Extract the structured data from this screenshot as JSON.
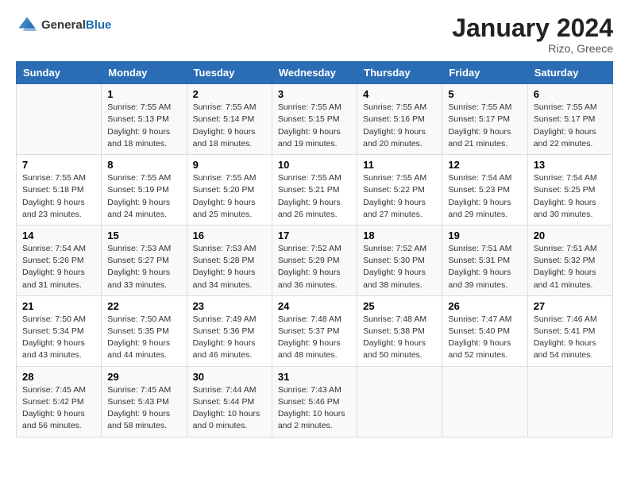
{
  "header": {
    "logo_general": "General",
    "logo_blue": "Blue",
    "month_title": "January 2024",
    "location": "Rizo, Greece"
  },
  "weekdays": [
    "Sunday",
    "Monday",
    "Tuesday",
    "Wednesday",
    "Thursday",
    "Friday",
    "Saturday"
  ],
  "weeks": [
    [
      {
        "day": "",
        "sunrise": "",
        "sunset": "",
        "daylight": ""
      },
      {
        "day": "1",
        "sunrise": "Sunrise: 7:55 AM",
        "sunset": "Sunset: 5:13 PM",
        "daylight": "Daylight: 9 hours and 18 minutes."
      },
      {
        "day": "2",
        "sunrise": "Sunrise: 7:55 AM",
        "sunset": "Sunset: 5:14 PM",
        "daylight": "Daylight: 9 hours and 18 minutes."
      },
      {
        "day": "3",
        "sunrise": "Sunrise: 7:55 AM",
        "sunset": "Sunset: 5:15 PM",
        "daylight": "Daylight: 9 hours and 19 minutes."
      },
      {
        "day": "4",
        "sunrise": "Sunrise: 7:55 AM",
        "sunset": "Sunset: 5:16 PM",
        "daylight": "Daylight: 9 hours and 20 minutes."
      },
      {
        "day": "5",
        "sunrise": "Sunrise: 7:55 AM",
        "sunset": "Sunset: 5:17 PM",
        "daylight": "Daylight: 9 hours and 21 minutes."
      },
      {
        "day": "6",
        "sunrise": "Sunrise: 7:55 AM",
        "sunset": "Sunset: 5:17 PM",
        "daylight": "Daylight: 9 hours and 22 minutes."
      }
    ],
    [
      {
        "day": "7",
        "sunrise": "Sunrise: 7:55 AM",
        "sunset": "Sunset: 5:18 PM",
        "daylight": "Daylight: 9 hours and 23 minutes."
      },
      {
        "day": "8",
        "sunrise": "Sunrise: 7:55 AM",
        "sunset": "Sunset: 5:19 PM",
        "daylight": "Daylight: 9 hours and 24 minutes."
      },
      {
        "day": "9",
        "sunrise": "Sunrise: 7:55 AM",
        "sunset": "Sunset: 5:20 PM",
        "daylight": "Daylight: 9 hours and 25 minutes."
      },
      {
        "day": "10",
        "sunrise": "Sunrise: 7:55 AM",
        "sunset": "Sunset: 5:21 PM",
        "daylight": "Daylight: 9 hours and 26 minutes."
      },
      {
        "day": "11",
        "sunrise": "Sunrise: 7:55 AM",
        "sunset": "Sunset: 5:22 PM",
        "daylight": "Daylight: 9 hours and 27 minutes."
      },
      {
        "day": "12",
        "sunrise": "Sunrise: 7:54 AM",
        "sunset": "Sunset: 5:23 PM",
        "daylight": "Daylight: 9 hours and 29 minutes."
      },
      {
        "day": "13",
        "sunrise": "Sunrise: 7:54 AM",
        "sunset": "Sunset: 5:25 PM",
        "daylight": "Daylight: 9 hours and 30 minutes."
      }
    ],
    [
      {
        "day": "14",
        "sunrise": "Sunrise: 7:54 AM",
        "sunset": "Sunset: 5:26 PM",
        "daylight": "Daylight: 9 hours and 31 minutes."
      },
      {
        "day": "15",
        "sunrise": "Sunrise: 7:53 AM",
        "sunset": "Sunset: 5:27 PM",
        "daylight": "Daylight: 9 hours and 33 minutes."
      },
      {
        "day": "16",
        "sunrise": "Sunrise: 7:53 AM",
        "sunset": "Sunset: 5:28 PM",
        "daylight": "Daylight: 9 hours and 34 minutes."
      },
      {
        "day": "17",
        "sunrise": "Sunrise: 7:52 AM",
        "sunset": "Sunset: 5:29 PM",
        "daylight": "Daylight: 9 hours and 36 minutes."
      },
      {
        "day": "18",
        "sunrise": "Sunrise: 7:52 AM",
        "sunset": "Sunset: 5:30 PM",
        "daylight": "Daylight: 9 hours and 38 minutes."
      },
      {
        "day": "19",
        "sunrise": "Sunrise: 7:51 AM",
        "sunset": "Sunset: 5:31 PM",
        "daylight": "Daylight: 9 hours and 39 minutes."
      },
      {
        "day": "20",
        "sunrise": "Sunrise: 7:51 AM",
        "sunset": "Sunset: 5:32 PM",
        "daylight": "Daylight: 9 hours and 41 minutes."
      }
    ],
    [
      {
        "day": "21",
        "sunrise": "Sunrise: 7:50 AM",
        "sunset": "Sunset: 5:34 PM",
        "daylight": "Daylight: 9 hours and 43 minutes."
      },
      {
        "day": "22",
        "sunrise": "Sunrise: 7:50 AM",
        "sunset": "Sunset: 5:35 PM",
        "daylight": "Daylight: 9 hours and 44 minutes."
      },
      {
        "day": "23",
        "sunrise": "Sunrise: 7:49 AM",
        "sunset": "Sunset: 5:36 PM",
        "daylight": "Daylight: 9 hours and 46 minutes."
      },
      {
        "day": "24",
        "sunrise": "Sunrise: 7:48 AM",
        "sunset": "Sunset: 5:37 PM",
        "daylight": "Daylight: 9 hours and 48 minutes."
      },
      {
        "day": "25",
        "sunrise": "Sunrise: 7:48 AM",
        "sunset": "Sunset: 5:38 PM",
        "daylight": "Daylight: 9 hours and 50 minutes."
      },
      {
        "day": "26",
        "sunrise": "Sunrise: 7:47 AM",
        "sunset": "Sunset: 5:40 PM",
        "daylight": "Daylight: 9 hours and 52 minutes."
      },
      {
        "day": "27",
        "sunrise": "Sunrise: 7:46 AM",
        "sunset": "Sunset: 5:41 PM",
        "daylight": "Daylight: 9 hours and 54 minutes."
      }
    ],
    [
      {
        "day": "28",
        "sunrise": "Sunrise: 7:45 AM",
        "sunset": "Sunset: 5:42 PM",
        "daylight": "Daylight: 9 hours and 56 minutes."
      },
      {
        "day": "29",
        "sunrise": "Sunrise: 7:45 AM",
        "sunset": "Sunset: 5:43 PM",
        "daylight": "Daylight: 9 hours and 58 minutes."
      },
      {
        "day": "30",
        "sunrise": "Sunrise: 7:44 AM",
        "sunset": "Sunset: 5:44 PM",
        "daylight": "Daylight: 10 hours and 0 minutes."
      },
      {
        "day": "31",
        "sunrise": "Sunrise: 7:43 AM",
        "sunset": "Sunset: 5:46 PM",
        "daylight": "Daylight: 10 hours and 2 minutes."
      },
      {
        "day": "",
        "sunrise": "",
        "sunset": "",
        "daylight": ""
      },
      {
        "day": "",
        "sunrise": "",
        "sunset": "",
        "daylight": ""
      },
      {
        "day": "",
        "sunrise": "",
        "sunset": "",
        "daylight": ""
      }
    ]
  ]
}
